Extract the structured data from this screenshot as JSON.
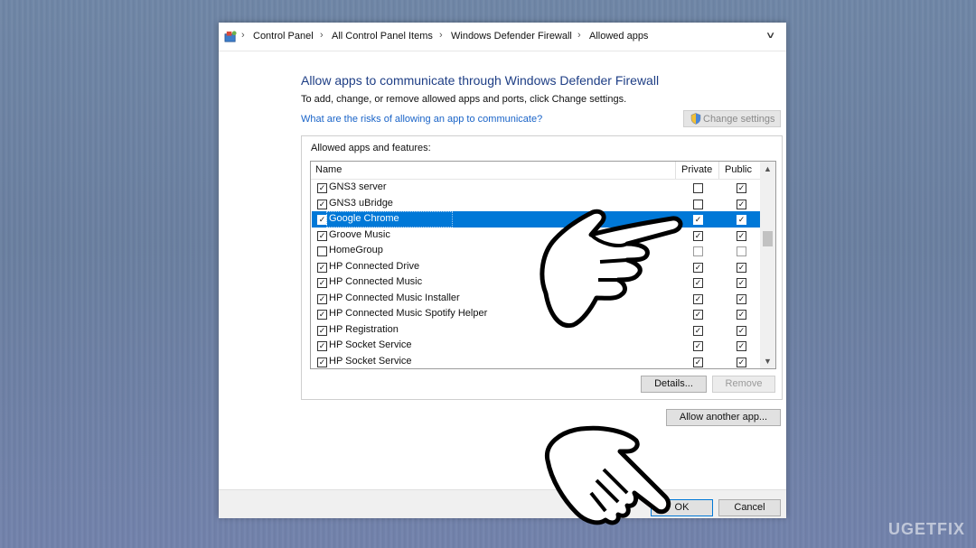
{
  "breadcrumb": [
    "Control Panel",
    "All Control Panel Items",
    "Windows Defender Firewall",
    "Allowed apps"
  ],
  "page": {
    "title": "Allow apps to communicate through Windows Defender Firewall",
    "subtitle": "To add, change, or remove allowed apps and ports, click Change settings.",
    "risk_link": "What are the risks of allowing an app to communicate?",
    "change_settings": "Change settings"
  },
  "list": {
    "group_label": "Allowed apps and features:",
    "columns": {
      "name": "Name",
      "private": "Private",
      "public": "Public"
    },
    "rows": [
      {
        "name": "GNS3 server",
        "enabled": true,
        "private": false,
        "public": true
      },
      {
        "name": "GNS3 uBridge",
        "enabled": true,
        "private": false,
        "public": true
      },
      {
        "name": "Google Chrome",
        "enabled": true,
        "private": true,
        "public": true,
        "selected": true
      },
      {
        "name": "Groove Music",
        "enabled": true,
        "private": true,
        "public": true
      },
      {
        "name": "HomeGroup",
        "enabled": false,
        "private": false,
        "public": false
      },
      {
        "name": "HP Connected Drive",
        "enabled": true,
        "private": true,
        "public": true
      },
      {
        "name": "HP Connected Music",
        "enabled": true,
        "private": true,
        "public": true
      },
      {
        "name": "HP Connected Music Installer",
        "enabled": true,
        "private": true,
        "public": true
      },
      {
        "name": "HP Connected Music Spotify Helper",
        "enabled": true,
        "private": true,
        "public": true
      },
      {
        "name": "HP Registration",
        "enabled": true,
        "private": true,
        "public": true
      },
      {
        "name": "HP Socket Service",
        "enabled": true,
        "private": true,
        "public": true
      },
      {
        "name": "HP Socket Service",
        "enabled": true,
        "private": true,
        "public": true
      }
    ]
  },
  "buttons": {
    "details": "Details...",
    "remove": "Remove",
    "allow_another": "Allow another app...",
    "ok": "OK",
    "cancel": "Cancel"
  },
  "watermark": "UGETFIX"
}
